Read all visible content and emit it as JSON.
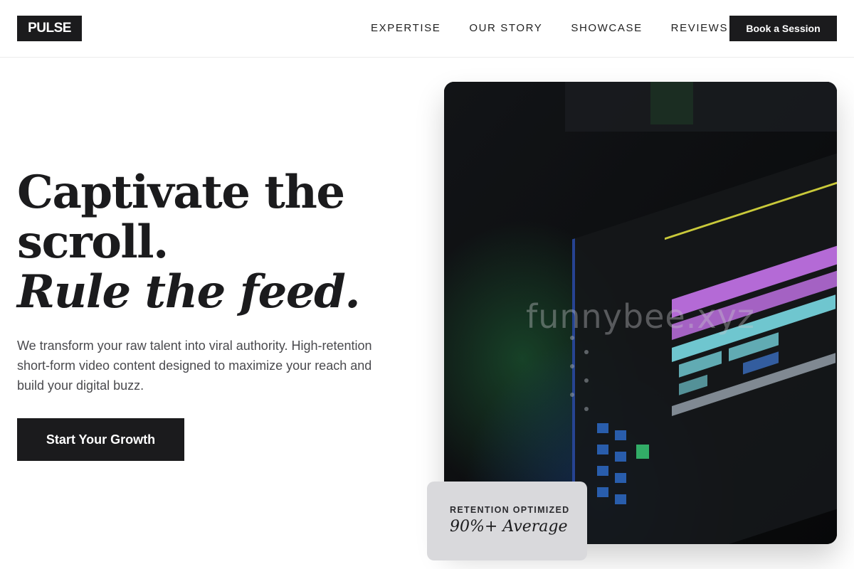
{
  "brand": {
    "logo_text": "PULSE"
  },
  "nav": {
    "items": [
      {
        "label": "EXPERTISE"
      },
      {
        "label": "OUR STORY"
      },
      {
        "label": "SHOWCASE"
      },
      {
        "label": "REVIEWS"
      }
    ],
    "cta_label": "Book a Session"
  },
  "hero": {
    "headline_line1": "Captivate the",
    "headline_line2": "scroll.",
    "headline_line3": "Rule the feed.",
    "subtext": "We transform your raw talent into viral authority. High-retention short-form video content designed to maximize your reach and build your digital buzz.",
    "cta_label": "Start Your Growth",
    "image_watermark": "funnybee.xyz"
  },
  "stat_card": {
    "label": "RETENTION OPTIMIZED",
    "value": "90%+ Average"
  },
  "colors": {
    "primary_dark": "#1b1b1d",
    "background": "#ffffff",
    "stat_card_bg": "#d9d9dc",
    "timeline_purple": "#b46ad6",
    "timeline_cyan": "#6fc6cf",
    "timeline_yellow": "#c9c93a"
  }
}
